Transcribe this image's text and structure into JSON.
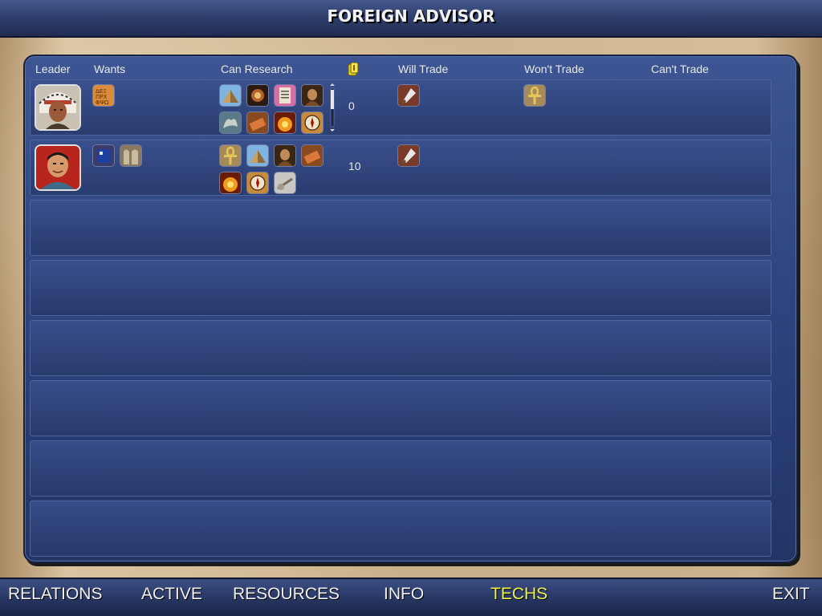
{
  "window": {
    "title": "FOREIGN ADVISOR"
  },
  "columns": {
    "leader": "Leader",
    "wants": "Wants",
    "can_research": "Can Research",
    "gold_icon": "gold-coin-icon",
    "will_trade": "Will Trade",
    "wont_trade": "Won't Trade",
    "cant_trade": "Can't Trade"
  },
  "rows": [
    {
      "leader_portrait": "native-chief-portrait",
      "wants": [
        "alphabet-tech-icon"
      ],
      "can_research": [
        "pyramid-tech-icon",
        "ceremony-tech-icon",
        "writing-tech-icon",
        "mysticism-tech-icon",
        "dragon-tech-icon",
        "construction-tech-icon",
        "bronze-tech-icon",
        "compass-tech-icon"
      ],
      "gold": "0",
      "will_trade": [
        "arrowhead-tech-icon"
      ],
      "wont_trade": [
        "ankh-tech-icon"
      ],
      "cant_trade": []
    },
    {
      "leader_portrait": "chinese-leader-portrait",
      "wants": [
        "book-tech-icon",
        "tablets-tech-icon"
      ],
      "can_research": [
        "ankh-tech-icon",
        "pyramid-tech-icon",
        "mysticism-tech-icon",
        "construction-tech-icon",
        "bronze-tech-icon",
        "compass-tech-icon",
        "wheel-tech-icon"
      ],
      "gold": "10",
      "will_trade": [
        "arrowhead-tech-icon"
      ],
      "wont_trade": [],
      "cant_trade": []
    }
  ],
  "nav": {
    "relations": "RELATIONS",
    "active": "ACTIVE",
    "resources": "RESOURCES",
    "info": "INFO",
    "techs": "TECHS",
    "exit": "EXIT"
  },
  "colors": {
    "panel": "#2e4580",
    "active_tab": "#eef24a",
    "text": "#e8e8e8"
  }
}
